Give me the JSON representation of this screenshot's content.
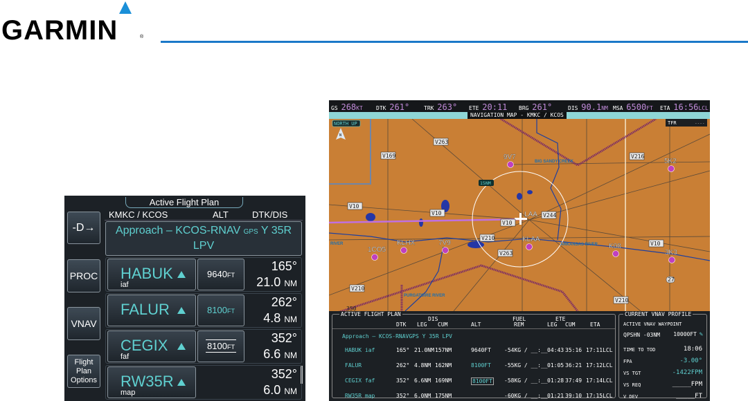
{
  "logo": {
    "text": "GARMIN",
    "reg": "®"
  },
  "flight_plan_panel": {
    "title": "Active Flight Plan",
    "buttons": {
      "direct_to": "-D→",
      "proc": "PROC",
      "vnav": "VNAV",
      "options": [
        "Flight",
        "Plan",
        "Options"
      ]
    },
    "headers": {
      "route": "KMKC / KCOS",
      "alt": "ALT",
      "dtk_dis": "DTK/DIS"
    },
    "procedure": {
      "line1a": "Approach – KCOS-RNAV",
      "gps": "GPS",
      "line1b": "Y 35R",
      "line2": "LPV"
    },
    "waypoints": [
      {
        "name": "HABUK",
        "role": "iaf",
        "alt": "9640",
        "alt_unit": "FT",
        "dtk": "165°",
        "dis": "21.0",
        "dis_unit": "NM"
      },
      {
        "name": "FALUR",
        "role": "",
        "alt": "8100",
        "alt_unit": "FT",
        "dtk": "262°",
        "dis": "4.8",
        "dis_unit": "NM"
      },
      {
        "name": "CEGIX",
        "role": "faf",
        "alt": "8100",
        "alt_unit": "FT",
        "dtk": "352°",
        "dis": "6.6",
        "dis_unit": "NM"
      },
      {
        "name": "RW35R",
        "role": "map",
        "alt": "",
        "alt_unit": "",
        "dtk": "352°",
        "dis": "6.0",
        "dis_unit": "NM"
      }
    ]
  },
  "mfd": {
    "topbar": [
      {
        "label": "GS",
        "value": "268",
        "unit": "KT"
      },
      {
        "label": "DTK",
        "value": "261°",
        "unit": ""
      },
      {
        "label": "TRK",
        "value": "263°",
        "unit": ""
      },
      {
        "label": "ETE",
        "value": "20:11",
        "unit": ""
      },
      {
        "label": "BRG",
        "value": "261°",
        "unit": ""
      },
      {
        "label": "DIS",
        "value": "90.1",
        "unit": "NM"
      },
      {
        "label": "MSA",
        "value": "6500",
        "unit": "FT"
      },
      {
        "label": "ETA",
        "value": "16:56",
        "unit": "LCL"
      }
    ],
    "map_title": "NAVIGATION MAP - KMKC / KCOS",
    "map": {
      "orientation": "NORTH UP",
      "north": "N",
      "tfr": "TFR",
      "tfr_value": "----",
      "range_ring": "15NM",
      "aircraft_id": "LAA",
      "airways": [
        "V263",
        "V169",
        "V10",
        "V10",
        "V244",
        "V216",
        "V210",
        "V263",
        "V10",
        "V210",
        "V210",
        "V10"
      ],
      "airports": [
        "9V7",
        "5K2",
        "KLHX",
        "1CO5",
        "7V9",
        "KLAA",
        "K08",
        "3K3"
      ],
      "rivers": [
        "BIG SANDY CREEK",
        "ARKANSAS RIVER",
        "PURGATOIRE RIVER",
        "RIVER"
      ],
      "highway": "27",
      "other": "350"
    },
    "active_flight_plan": {
      "title": "ACTIVE FLIGHT PLAN",
      "headers": {
        "dis": "DIS",
        "fuel": "FUEL",
        "ete": "ETE",
        "dtk": "DTK",
        "leg": "LEG",
        "cum": "CUM",
        "alt": "ALT",
        "rem": "REM",
        "ete_leg": "LEG",
        "ete_cum": "CUM",
        "eta": "ETA"
      },
      "procedure": "Approach – KCOS-RNAVGPS Y 35R LPV",
      "rows": [
        {
          "wpt": "HABUK iaf",
          "dtk": "165°",
          "leg": "21.0NM",
          "cum": "157NM",
          "alt": "9640FT",
          "rem": "-54KG / __:__",
          "ete_leg": "04:43",
          "ete_cum": "35:16",
          "eta": "17:11LCL"
        },
        {
          "wpt": "FALUR",
          "dtk": "262°",
          "leg": "4.8NM",
          "cum": "162NM",
          "alt": "8100FT",
          "rem": "-55KG / __:__",
          "ete_leg": "01:05",
          "ete_cum": "36:21",
          "eta": "17:12LCL"
        },
        {
          "wpt": "CEGIX faf",
          "dtk": "352°",
          "leg": "6.6NM",
          "cum": "169NM",
          "alt": "8100FT",
          "rem": "-58KG / __:__",
          "ete_leg": "01:28",
          "ete_cum": "37:49",
          "eta": "17:14LCL"
        },
        {
          "wpt": "RW35R map",
          "dtk": "352°",
          "leg": "6.0NM",
          "cum": "175NM",
          "alt": "",
          "rem": "-60KG / __:__",
          "ete_leg": "01:21",
          "ete_cum": "39:10",
          "eta": "17:15LCL"
        }
      ]
    },
    "vnav_profile": {
      "title": "CURRENT VNAV PROFILE",
      "active_label": "ACTIVE VNAV WAYPOINT",
      "waypoint": "QPSHN -03NM",
      "waypoint_alt": "10000FT",
      "items": [
        {
          "label": "TIME TO TOD",
          "value": "18:06"
        },
        {
          "label": "FPA",
          "value": "-3.00°"
        },
        {
          "label": "VS TGT",
          "value": "-1422FPM"
        },
        {
          "label": "VS REQ",
          "value": "_____FPM"
        },
        {
          "label": "V DEV",
          "value": "_____FT"
        }
      ]
    }
  }
}
